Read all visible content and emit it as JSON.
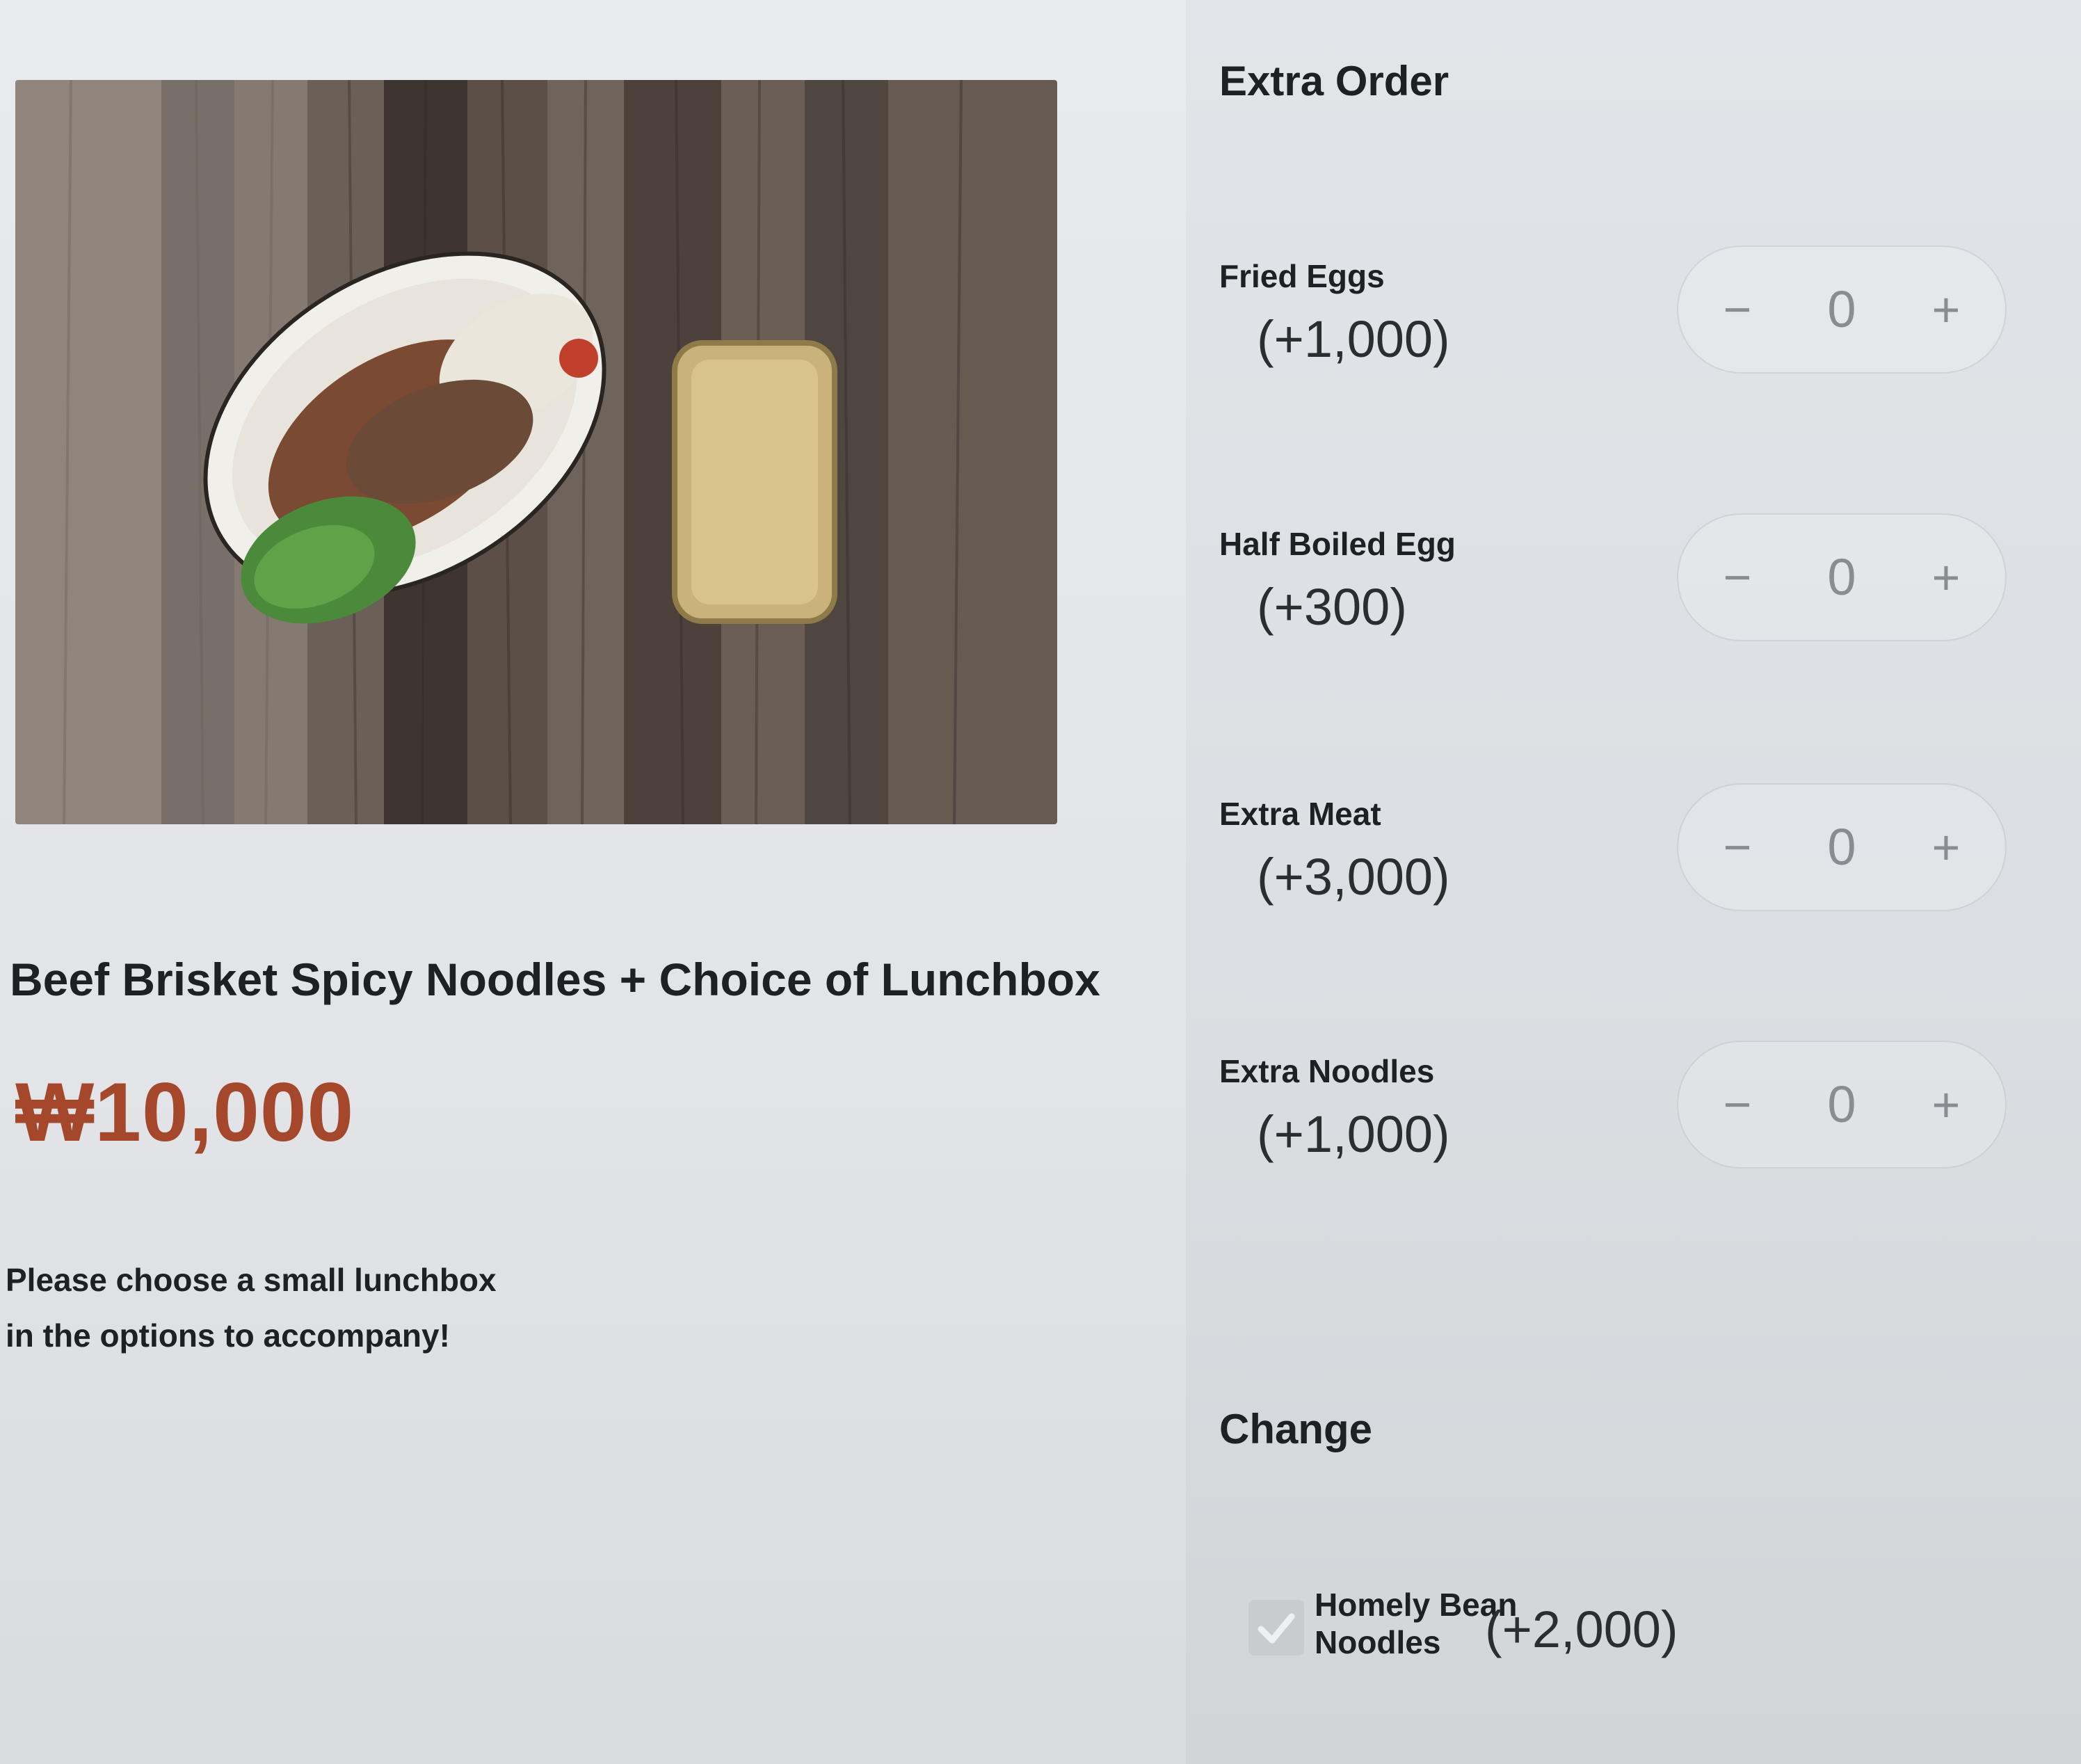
{
  "product": {
    "title": "Beef Brisket Spicy Noodles + Choice of Lunchbox",
    "price": "₩10,000",
    "note_line1": "Please choose a small lunchbox",
    "note_line2": "in the options to accompany!"
  },
  "extra_order": {
    "heading": "Extra Order",
    "items": [
      {
        "name": "Fried Eggs",
        "price": "(+1,000)",
        "quantity": "0"
      },
      {
        "name": "Half Boiled Egg",
        "price": "(+300)",
        "quantity": "0"
      },
      {
        "name": "Extra Meat",
        "price": "(+3,000)",
        "quantity": "0"
      },
      {
        "name": "Extra Noodles",
        "price": "(+1,000)",
        "quantity": "0"
      }
    ],
    "minus_symbol": "−",
    "plus_symbol": "+"
  },
  "change": {
    "heading": "Change",
    "option": {
      "name_line1": "Homely Bean",
      "name_line2": "Noodles",
      "price": "(+2,000)",
      "checked": true
    }
  },
  "colors": {
    "price_accent": "#a4472b",
    "stepper_text": "#8a8c91"
  },
  "icons": {
    "checkbox": "checkmark-icon",
    "decrement": "minus-icon",
    "increment": "plus-icon"
  }
}
